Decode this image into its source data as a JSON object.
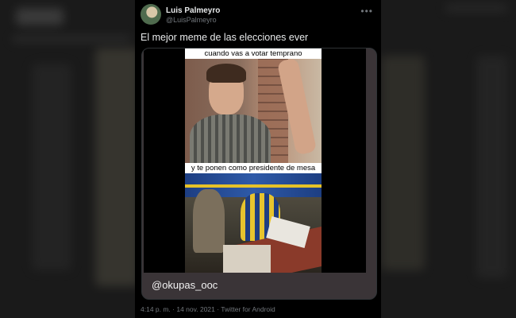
{
  "tweet": {
    "display_name": "Luis Palmeyro",
    "handle": "@LuisPalmeyro",
    "text": "El mejor meme de las elecciones ever",
    "more_icon": "more-horizontal-icon",
    "media": {
      "caption_top": "cuando vas a votar temprano",
      "caption_bottom": "y te ponen como presidente de mesa",
      "credit": "@okupas_ooc"
    },
    "timestamp": "4:14 p. m. · 14 nov. 2021 · Twitter for Android"
  },
  "colors": {
    "background": "#000000",
    "text_primary": "#e7e9ea",
    "text_secondary": "#71767b",
    "media_bg": "#3a3437"
  }
}
